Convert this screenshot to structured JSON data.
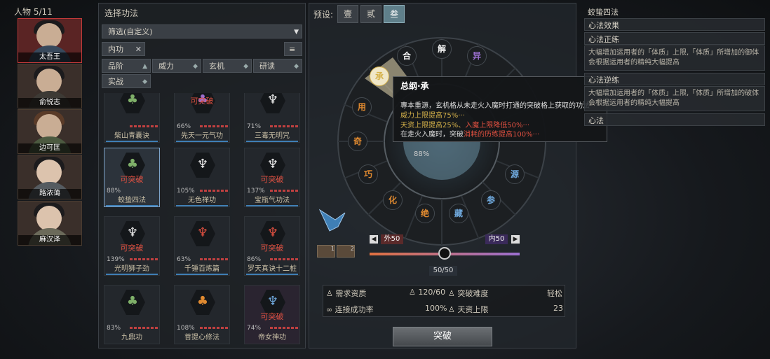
{
  "left": {
    "title": "人物 5/11",
    "characters": [
      {
        "name": "太吾王"
      },
      {
        "name": "俞锐志"
      },
      {
        "name": "边可匡"
      },
      {
        "name": "路浓蔼"
      },
      {
        "name": "麻汉泽"
      }
    ]
  },
  "mid": {
    "title": "选择功法",
    "filter_select": "筛选(自定义)",
    "filter_tag": "内功",
    "sort_buttons": [
      "品阶",
      "威力",
      "玄机",
      "研读",
      "实战"
    ],
    "breakable_label": "可突破",
    "skills": [
      {
        "name": "柴山青囊诀",
        "pct": ""
      },
      {
        "name": "先天一元气功",
        "pct": "66%",
        "breakable": "可突破"
      },
      {
        "name": "三毒无明咒",
        "pct": "71%"
      },
      {
        "name": "蛟蛰四法",
        "pct": "88%",
        "breakable": "可突破"
      },
      {
        "name": "无色禅功",
        "pct": "105%"
      },
      {
        "name": "宝瓶气功法",
        "pct": "137%",
        "breakable": "可突破"
      },
      {
        "name": "光明狮子劲",
        "pct": "139%",
        "breakable": "可突破"
      },
      {
        "name": "千锤百炼篇",
        "pct": "63%"
      },
      {
        "name": "罗天真诀十二桩",
        "pct": "86%",
        "breakable": "可突破"
      },
      {
        "name": "九鼎功",
        "pct": "83%"
      },
      {
        "name": "菩提心修法",
        "pct": "108%"
      },
      {
        "name": "帝女神功",
        "pct": "74%",
        "breakable": "可突破"
      }
    ]
  },
  "center": {
    "preset_label": "预设:",
    "presets": [
      "壹",
      "贰",
      "叁"
    ],
    "wheel_nodes": [
      "合",
      "解",
      "异",
      "承",
      "用",
      "奇",
      "巧",
      "化",
      "绝",
      "藏",
      "参",
      "源"
    ],
    "core_pct": "88%",
    "tooltip": {
      "title": "总纲·承",
      "line1": "專本重源，玄机格从未走火入魔时打通的突破格上获取的功法",
      "line2": "威力上限提高75%···",
      "line3a": "天资上限提高25%、",
      "line3b": "入魔上限降低50%···",
      "line4a": "在走火入魔时，突破",
      "line4b": "消耗的历练提高100%···"
    },
    "slots": [
      {
        "label": "1"
      },
      {
        "label": "2"
      }
    ],
    "slider": {
      "left_label": "外50",
      "right_label": "内50",
      "value_text": "50/50",
      "value": 50
    },
    "stats": {
      "req_label": "需求资质",
      "req_value": "120/60",
      "difficulty_label": "突破难度",
      "difficulty_value": "轻松",
      "success_label": "连接成功率",
      "success_value": "100%",
      "talent_label": "天资上限",
      "talent_value": "23"
    },
    "break_button": "突破"
  },
  "right": {
    "title": "蛟蛰四法",
    "effect_label": "心法效果",
    "zheng_title": "心法正练",
    "zheng_text": "大幅增加运用者的「体质」上限,「体质」所增加的御体会根据运用者的精纯大幅提高",
    "ni_title": "心法逆练",
    "ni_text": "大幅增加运用者的「体质」上限,「体质」所增加的破体会根据运用者的精纯大幅提高",
    "extra": "心法"
  },
  "colors": {
    "accent_red": "#e05040",
    "accent_blue": "#6fa8dc",
    "gold": "#d6b24a",
    "purple": "#9b6fd0"
  }
}
